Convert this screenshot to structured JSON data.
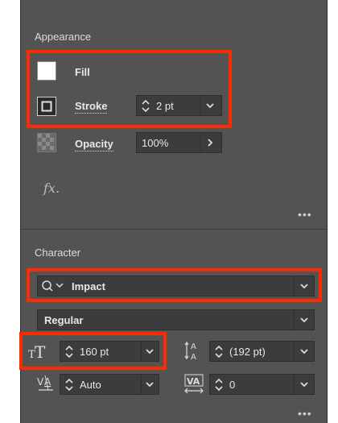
{
  "appearance": {
    "title": "Appearance",
    "fill_label": "Fill",
    "stroke_label": "Stroke",
    "stroke_weight": "2 pt",
    "opacity_label": "Opacity",
    "opacity_value": "100%",
    "fx_label": "fx."
  },
  "character": {
    "title": "Character",
    "font_family": "Impact",
    "font_style": "Regular",
    "font_size": "160 pt",
    "leading": "(192 pt)",
    "kerning": "Auto",
    "tracking": "0"
  },
  "colors": {
    "panel_bg": "#535353",
    "field_bg": "#3c3c3c",
    "highlight": "#ff2a00"
  }
}
